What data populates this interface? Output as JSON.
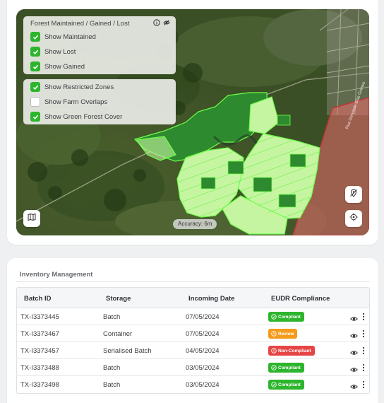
{
  "map": {
    "layer_panel": {
      "title": "Forest Maintained / Gained / Lost",
      "info_icon": "info-circle-icon",
      "hide_icon": "eye-off-icon",
      "items": [
        {
          "label": "Show Maintained",
          "checked": true
        },
        {
          "label": "Show Lost",
          "checked": true
        },
        {
          "label": "Show Gained",
          "checked": true
        }
      ]
    },
    "overlay_panel": {
      "items": [
        {
          "label": "Show Restricted Zones",
          "checked": true
        },
        {
          "label": "Show Farm Overlaps",
          "checked": false
        },
        {
          "label": "Show Green Forest Cover",
          "checked": true
        }
      ]
    },
    "accuracy": "Accuracy: 6m",
    "basemap_button_icon": "map-icon",
    "clear_selection_icon": "map-pin-off-icon",
    "locate_icon": "crosshair-icon",
    "colors": {
      "satellite_base": "#3e5228",
      "forest_cover": "#2e8a2e",
      "forest_outline": "#6bff48",
      "gained_fill": "#c6f5a2",
      "restricted_zone": "#ef6d6d"
    }
  },
  "inventory": {
    "title": "Inventory Management",
    "columns": [
      "Batch ID",
      "Storage",
      "Incoming Date",
      "EUDR Compliance"
    ],
    "rows": [
      {
        "batch_id": "TX-I3373445",
        "storage": "Batch",
        "date": "07/05/2024",
        "status": "Compliant",
        "status_type": "ok"
      },
      {
        "batch_id": "TX-I3373467",
        "storage": "Container",
        "date": "07/05/2024",
        "status": "Review",
        "status_type": "review"
      },
      {
        "batch_id": "TX-I3373457",
        "storage": "Serialised Batch",
        "date": "04/05/2024",
        "status": "Non-Compliant",
        "status_type": "bad"
      },
      {
        "batch_id": "TX-I3373488",
        "storage": "Batch",
        "date": "03/05/2024",
        "status": "Compliant",
        "status_type": "ok"
      },
      {
        "batch_id": "TX-I3373498",
        "storage": "Batch",
        "date": "03/05/2024",
        "status": "Compliant",
        "status_type": "ok"
      }
    ],
    "row_icons": {
      "view": "eye-icon",
      "more": "more-vertical-icon"
    },
    "status_colors": {
      "ok": "#2db52d",
      "review": "#f59a1a",
      "bad": "#e64545"
    }
  }
}
